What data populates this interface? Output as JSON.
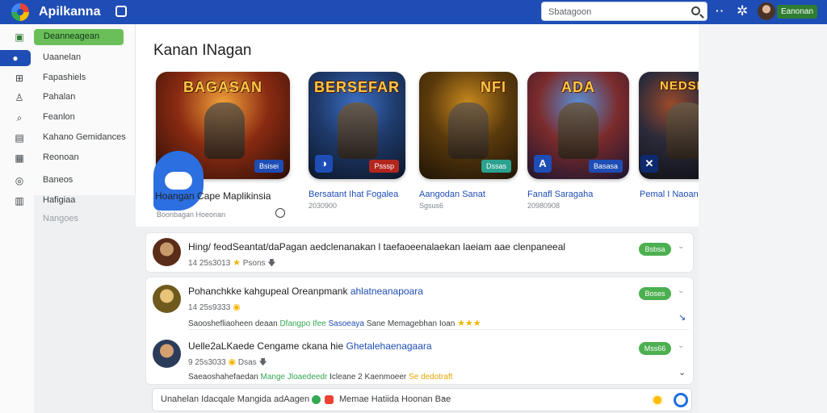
{
  "app": {
    "title": "Apilkanna"
  },
  "search": {
    "placeholder": "Sbatagoon"
  },
  "account": {
    "label": "Eanonan"
  },
  "sidebar": {
    "items": [
      {
        "label": "Deanneagean",
        "icon": "image-icon"
      },
      {
        "label": "Uaanelan",
        "icon": "puzzle-icon"
      },
      {
        "label": "Fapashiels",
        "icon": "grid-icon"
      },
      {
        "label": "Pahalan",
        "icon": "user-icon"
      },
      {
        "label": "Feanlon",
        "icon": "search-icon"
      },
      {
        "label": "Kahano Gemidances",
        "icon": "document-icon"
      },
      {
        "label": "Reonoan",
        "icon": "calendar-icon"
      },
      {
        "label": "Baneos",
        "icon": "globe-icon"
      },
      {
        "label": "Hafigiaa",
        "icon": "stack-icon"
      },
      {
        "label": "Nangoes"
      }
    ]
  },
  "featured": {
    "title": "Kanan INagan",
    "cards": [
      {
        "headline": "BAGASAN",
        "badge": "Bsisei",
        "title": "Hoangan Cape Maplikinsia",
        "sub": "Boonbagan Hoeonan",
        "colors": [
          "#f2a23a",
          "#8a2b12",
          "#2a0e06"
        ]
      },
      {
        "headline": "BERSEFAR",
        "badge": "Psssp",
        "title": "Bersatant Ihat Fogalea",
        "sub": "2030900",
        "colors": [
          "#3a6ec2",
          "#1f3a6b",
          "#0c1628"
        ]
      },
      {
        "headline": "NFI",
        "badge": "Dssas",
        "title": "Aangodan Sanat",
        "sub": "Sgsus6",
        "colors": [
          "#c98a1e",
          "#5a3a0c",
          "#1f1406"
        ]
      },
      {
        "headline": "ADA",
        "badge": "Basasa",
        "title": "Fanafl Saragaha",
        "sub": "20980908",
        "colors": [
          "#5a8fd6",
          "#7b2b2b",
          "#1b1530"
        ]
      },
      {
        "headline": "NEDSE",
        "title": "Pemal I Naoanser",
        "colors": [
          "#9a4a2a",
          "#2b2a3a",
          "#121218"
        ]
      }
    ]
  },
  "feed": {
    "rows": [
      {
        "title": "Hing/ feodSeantat/daPagan aedclenanakan l taefaoeenalaekan laeiam aae clenpaneeal",
        "meta_num": "14 25s3013",
        "meta_extra": "Psons",
        "pill": "Bsbsa"
      },
      {
        "title_main": "Pohanchkke kahgupeal Oreanpmank",
        "title_link": "ahlatneanapoara",
        "meta_num": "14 25s9333",
        "desc_plain": "Saooshefliaoheen deaan",
        "desc_green": "Dfangpo Ifee",
        "desc_blue": "Sasoeaya",
        "desc_tail": "Sane Memagebhan Ioan",
        "pill": "Boses"
      },
      {
        "title_main": "Uelle2aLKaede Cengame ckana hie",
        "title_link": "Ghetalehaenagaara",
        "meta_num": "9 25s3033",
        "meta_extra": "Dsas",
        "desc_plain": "Saeaoshahefaedan",
        "desc_green": "Mange Jloaedeedr",
        "desc_tail": "Icleane 2 Kaenmoeer",
        "desc_orange": "Se dedotraft",
        "pill": "Mss66"
      }
    ]
  },
  "composer": {
    "placeholder": "Unahelan Idacqale Mangida adAagen",
    "label": "Memae Hatiida Hoonan Bae"
  }
}
